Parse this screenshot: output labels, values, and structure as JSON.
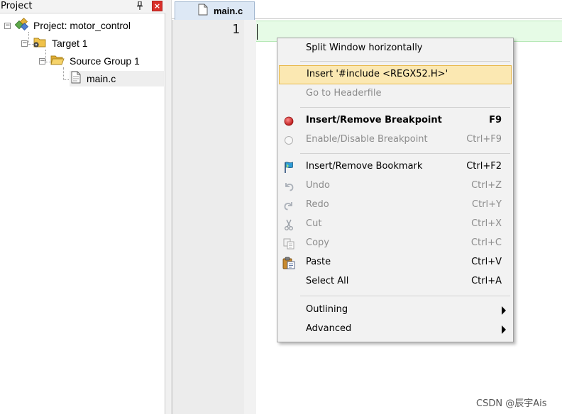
{
  "project_panel": {
    "title": "Project",
    "pin_glyph": "ߟ",
    "close_glyph": "×",
    "tree": {
      "root_label": "Project: motor_control",
      "target_label": "Target 1",
      "group_label": "Source Group 1",
      "file_label": "main.c"
    }
  },
  "editor": {
    "tab_label": "main.c",
    "line_number": "1"
  },
  "context_menu": {
    "items": [
      {
        "label": "Split Window horizontally",
        "shortcut": ""
      },
      {
        "label": "Insert '#include <REGX52.H>'",
        "shortcut": ""
      },
      {
        "label": "Go to Headerfile",
        "shortcut": ""
      },
      {
        "label": "Insert/Remove Breakpoint",
        "shortcut": "F9"
      },
      {
        "label": "Enable/Disable Breakpoint",
        "shortcut": "Ctrl+F9"
      },
      {
        "label": "Insert/Remove Bookmark",
        "shortcut": "Ctrl+F2"
      },
      {
        "label": "Undo",
        "shortcut": "Ctrl+Z"
      },
      {
        "label": "Redo",
        "shortcut": "Ctrl+Y"
      },
      {
        "label": "Cut",
        "shortcut": "Ctrl+X"
      },
      {
        "label": "Copy",
        "shortcut": "Ctrl+C"
      },
      {
        "label": "Paste",
        "shortcut": "Ctrl+V"
      },
      {
        "label": "Select All",
        "shortcut": "Ctrl+A"
      },
      {
        "label": "Outlining",
        "shortcut": ""
      },
      {
        "label": "Advanced",
        "shortcut": ""
      }
    ]
  },
  "watermark": "CSDN @辰宇Ais",
  "colors": {
    "highlight_bg": "#fbe8b2",
    "highlight_border": "#e8b94c",
    "current_line_bg": "#e6fbe6",
    "breakpoint_red": "#cc1f1f",
    "close_red": "#d9302b"
  }
}
